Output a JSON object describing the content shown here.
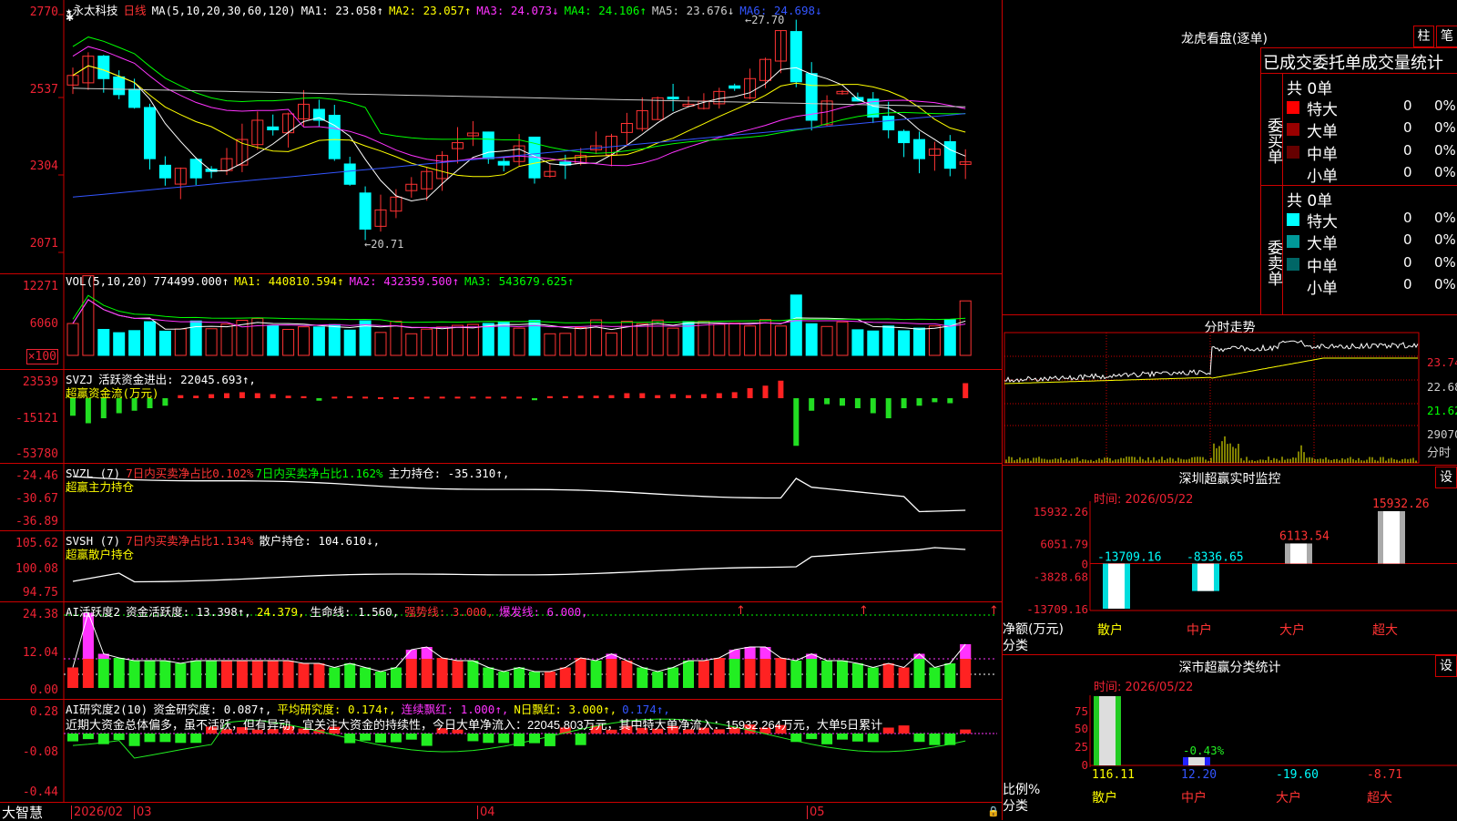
{
  "stock": {
    "name": "永太科技",
    "period": "日线"
  },
  "kline": {
    "ma_label": "MA(5,10,20,30,60,120)",
    "ma": [
      {
        "name": "MA1",
        "value": "23.058↑",
        "color": "#ffffff"
      },
      {
        "name": "MA2",
        "value": "23.057↑",
        "color": "#ffff00"
      },
      {
        "name": "MA3",
        "value": "24.073↓",
        "color": "#ff33ff"
      },
      {
        "name": "MA4",
        "value": "24.106↑",
        "color": "#00ff00"
      },
      {
        "name": "MA5",
        "value": "23.676↓",
        "color": "#cccccc"
      },
      {
        "name": "MA6",
        "value": "24.698↓",
        "color": "#3355ff"
      }
    ],
    "yticks": [
      "2770",
      "2537",
      "2304",
      "2071"
    ],
    "high_note": "27.70",
    "low_note": "20.71"
  },
  "vol": {
    "label": "VOL(5,10,20)",
    "value": "774499.000↑",
    "ma": [
      {
        "name": "MA1",
        "value": "440810.594↑",
        "color": "#ffffff"
      },
      {
        "name": "MA2",
        "value": "432359.500↑",
        "color": "#ff33ff"
      },
      {
        "name": "MA3",
        "value": "543679.625↑",
        "color": "#00ff00"
      }
    ],
    "yticks": [
      "12271",
      "6060"
    ],
    "unit": "×100"
  },
  "svzj": {
    "label": "SVZJ",
    "line1": "活跃资金进出: 22045.693↑,",
    "line2": "超赢资金流(万元)",
    "yticks": [
      "23539",
      "-15121",
      "-53780"
    ]
  },
  "svzl": {
    "label": "SVZL (7)",
    "a": "7日内买卖净占比0.102%",
    "b": "7日内买卖净占比1.162%",
    "c": "主力持仓: -35.310↑,",
    "line2": "超赢主力持仓",
    "yticks": [
      "-24.46",
      "-30.67",
      "-36.89"
    ]
  },
  "svsh": {
    "label": "SVSH (7)",
    "a": "7日内买卖净占比1.134%",
    "b": "散户持仓: 104.610↓,",
    "line2": "超赢散户持仓",
    "yticks": [
      "105.62",
      "100.08",
      "94.75"
    ]
  },
  "ai1": {
    "label": "AI活跃度2",
    "a": "资金活跃度: 13.398↑,",
    "b": "24.379,",
    "c": "生命线: 1.560,",
    "d": "强势线: 3.000,",
    "e": "爆发线: 6.000,",
    "yticks": [
      "24.38",
      "12.04",
      "0.00"
    ]
  },
  "ai2": {
    "label": "AI研究度2(10)",
    "a": "资金研究度: 0.087↑,",
    "b": "平均研究度: 0.174↑,",
    "c": "连续飘红: 1.000↑,",
    "d": "N日飘红: 3.000↑,",
    "e": "0.174↑,",
    "comment": "近期大资金总体偏多，虽不活跃，但有异动，宜关注大资金的持续性，今日大单净流入：22045.803万元，其中特大单净流入：15932.264万元，大单5日累计",
    "yticks": [
      "0.28",
      "-0.08",
      "-0.44"
    ]
  },
  "xaxis": {
    "brand": "大智慧",
    "labels": [
      "2026/02",
      "03",
      "04",
      "05"
    ]
  },
  "dragon": {
    "title": "龙虎看盘(逐单)",
    "btn1": "柱",
    "btn2": "笔",
    "header": "已成交委托单成交量统计",
    "buy": {
      "side": "委买单",
      "total": "共 0单",
      "rows": [
        {
          "label": "特大",
          "v": "0",
          "p": "0%",
          "color": "#ff0000"
        },
        {
          "label": "大单",
          "v": "0",
          "p": "0%",
          "color": "#990000"
        },
        {
          "label": "中单",
          "v": "0",
          "p": "0%",
          "color": "#660000"
        },
        {
          "label": "小单",
          "v": "0",
          "p": "0%",
          "color": "#000000"
        }
      ]
    },
    "sell": {
      "side": "委卖单",
      "total": "共 0单",
      "rows": [
        {
          "label": "特大",
          "v": "0",
          "p": "0%",
          "color": "#00ffff"
        },
        {
          "label": "大单",
          "v": "0",
          "p": "0%",
          "color": "#009999"
        },
        {
          "label": "中单",
          "v": "0",
          "p": "0%",
          "color": "#006666"
        },
        {
          "label": "小单",
          "v": "0",
          "p": "0%",
          "color": "#000000"
        }
      ]
    }
  },
  "intraday": {
    "title": "分时走势",
    "ylabels": [
      "23.74",
      "22.68",
      "21.62"
    ],
    "vol_label": "29070",
    "vol_unit": "分时"
  },
  "szmonitor": {
    "title": "深圳超赢实时监控",
    "btn": "设",
    "time": "时间: 2026/05/22",
    "yticks": [
      "15932.26",
      "6051.79",
      "0",
      "-3828.68",
      "-13709.16"
    ],
    "ylabel1": "净额(万元)",
    "ylabel2": "分类",
    "cats": [
      "散户",
      "中户",
      "大户",
      "超大"
    ],
    "chart_data": {
      "type": "bar",
      "categories": [
        "散户",
        "中户",
        "大户",
        "超大"
      ],
      "values": [
        -13709.16,
        -8336.65,
        6113.54,
        15932.26
      ],
      "ylim": [
        -13709.16,
        15932.26
      ],
      "ylabel": "净额(万元)"
    }
  },
  "szclass": {
    "title": "深市超赢分类统计",
    "btn": "设",
    "time": "时间: 2026/05/22",
    "yticks": [
      "75",
      "50",
      "25",
      "0"
    ],
    "ylabel1": "比例%",
    "ylabel2": "分类",
    "cats": [
      "散户",
      "中户",
      "大户",
      "超大"
    ],
    "labels": [
      "116.11",
      "12.20",
      "-19.60",
      "-8.71"
    ],
    "bar_note": "-0.43%",
    "chart_data": {
      "type": "bar",
      "categories": [
        "散户",
        "中户",
        "大户",
        "超大"
      ],
      "values": [
        116.11,
        12.2,
        -19.6,
        -8.71
      ],
      "ylabel": "比例%"
    }
  }
}
